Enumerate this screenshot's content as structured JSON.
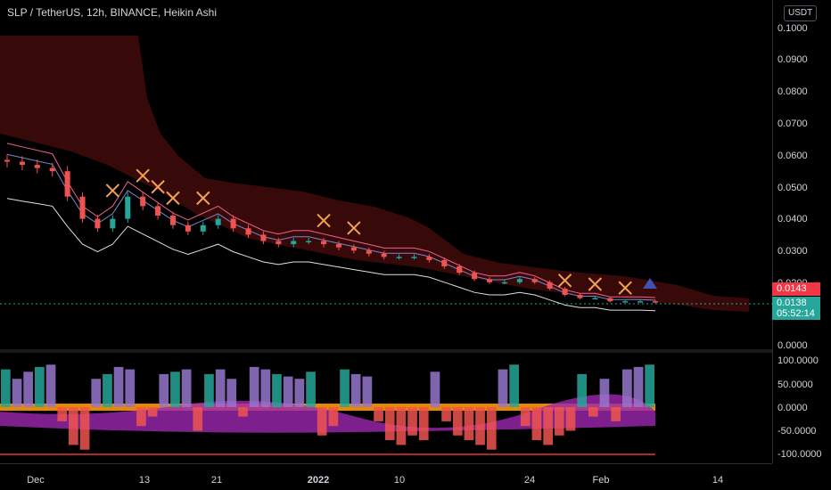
{
  "header": {
    "title": "SLP / TetherUS, 12h, BINANCE, Heikin Ashi",
    "currency": "USDT"
  },
  "price_axis": [
    "0.1000",
    "0.0900",
    "0.0800",
    "0.0700",
    "0.0600",
    "0.0500",
    "0.0400",
    "0.0300",
    "0.0200",
    "0.0000"
  ],
  "price_badges": {
    "last": "0.0143",
    "current": "0.0138",
    "countdown": "05:52:14"
  },
  "oscillator_axis": [
    "100.0000",
    "50.0000",
    "0.0000",
    "-50.0000",
    "-100.0000"
  ],
  "time_axis": [
    "Dec",
    "13",
    "21",
    "2022",
    "10",
    "24",
    "Feb",
    "14"
  ],
  "colors": {
    "background": "#000000",
    "bull": "#26a69a",
    "bear": "#ef5350",
    "cloud": "#3b0a0a",
    "signal_x": "#f2a154",
    "badge_last": "#f23645",
    "badge_current": "#26a69a"
  },
  "icons": [
    "cross-signal-icon",
    "triangle-up-signal-icon"
  ],
  "chart_data": [
    {
      "type": "candlestick",
      "style": "Heikin Ashi",
      "symbol": "SLP / TetherUS",
      "interval": "12h",
      "exchange": "BINANCE",
      "ylim": [
        0.0,
        0.1
      ],
      "close_approx": [
        0.058,
        0.057,
        0.056,
        0.055,
        0.047,
        0.04,
        0.037,
        0.04,
        0.047,
        0.044,
        0.041,
        0.038,
        0.036,
        0.038,
        0.04,
        0.037,
        0.035,
        0.033,
        0.032,
        0.033,
        0.033,
        0.032,
        0.031,
        0.03,
        0.029,
        0.028,
        0.028,
        0.028,
        0.027,
        0.025,
        0.023,
        0.021,
        0.02,
        0.02,
        0.021,
        0.02,
        0.018,
        0.016,
        0.015,
        0.015,
        0.014,
        0.014,
        0.014,
        0.0138
      ],
      "annotations": {
        "sell_cross_signals": 10,
        "buy_triangle_signals": 1
      }
    },
    {
      "type": "bar",
      "panel": "oscillator",
      "ylim": [
        -100,
        100
      ],
      "values_approx": [
        80,
        60,
        75,
        85,
        90,
        -30,
        -80,
        -90,
        60,
        70,
        85,
        80,
        -40,
        -20,
        70,
        75,
        80,
        -50,
        70,
        80,
        60,
        -20,
        85,
        80,
        70,
        65,
        60,
        75,
        -60,
        -40,
        80,
        70,
        65,
        -30,
        -70,
        -80,
        -60,
        -70,
        75,
        -30,
        -60,
        -70,
        -80,
        -90,
        80,
        90,
        -40,
        -70,
        -80,
        -60,
        -50,
        70,
        -20,
        60,
        -30,
        80,
        85,
        90
      ]
    }
  ]
}
